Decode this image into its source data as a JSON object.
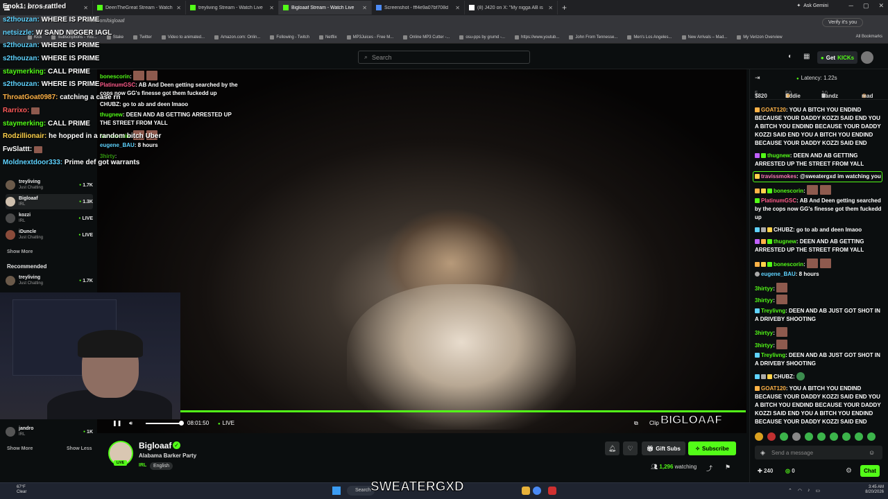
{
  "browser": {
    "tabs": [
      {
        "label": "Enok1 bros rattled",
        "active": false
      },
      {
        "label": "DeenTheGreat Stream - Watch",
        "active": false
      },
      {
        "label": "treyliving Stream - Watch Live",
        "active": false
      },
      {
        "label": "Bigloaaf Stream - Watch Live",
        "active": true
      },
      {
        "label": "Screenshot - fff4e9a07bf708d",
        "active": false
      },
      {
        "label": "(8) J420 on X: \"My nigga AB is",
        "active": false
      }
    ],
    "ask_gemini": "Ask Gemini",
    "url": "kick.com/bigloaaf",
    "verify": "Verify it's you",
    "bookmarks": [
      "Kick",
      "Subscriptions - You...",
      "Stake",
      "Twitter",
      "Video to animated...",
      "Amazon.com: Onlin...",
      "Following - Twitch",
      "Netflix",
      "MP3Juices - Free M...",
      "Online MP3 Cutter -...",
      "osu-pps by grumd -...",
      "https://www.youtub...",
      "John From Tennesse...",
      "Men's Los Angeles...",
      "New Arrivals – Mad...",
      "My Verizon Overview"
    ],
    "all_bookmarks": "All Bookmarks"
  },
  "kick_header": {
    "search_placeholder": "Search",
    "get_kicks": "Get KICKs",
    "get_kicks_prefix": "Get",
    "get_kicks_bold": "KICKs"
  },
  "sidebar": {
    "nav": [
      "Home",
      "Browse",
      "Following",
      "Drops"
    ],
    "following_header": "Following",
    "following": [
      {
        "name": "treyliving",
        "sub": "Just Chatting",
        "viewers": "1.7K"
      },
      {
        "name": "Bigloaaf",
        "sub": "IRL",
        "viewers": "1.3K"
      },
      {
        "name": "kozzi",
        "sub": "IRL",
        "viewers": "LIVE"
      },
      {
        "name": "iDuncle",
        "sub": "Just Chatting",
        "viewers": "LIVE"
      }
    ],
    "show_more": "Show More",
    "recommended_header": "Recommended",
    "recommended": [
      {
        "name": "treyliving",
        "sub": "Just Chatting",
        "viewers": "1.7K"
      }
    ],
    "bottom_item": {
      "name": "jandro",
      "sub": "IRL",
      "viewers": "1K"
    },
    "bottom_show_more": "Show More",
    "bottom_show_less": "Show Less"
  },
  "overlay_chat": [
    {
      "user": "Enok1:",
      "text": "bros rattled",
      "color": "#ffffff"
    },
    {
      "user": "s2thouzan:",
      "text": "WHERE IS PRIME",
      "color": "#5fd3ff"
    },
    {
      "user": "netsizzle:",
      "text": "W SAND NIGGER IAGL",
      "color": "#5fd3ff"
    },
    {
      "user": "s2thouzan:",
      "text": "WHERE IS PRIME",
      "color": "#5fd3ff"
    },
    {
      "user": "s2thouzan:",
      "text": "WHERE IS PRIME",
      "color": "#5fd3ff"
    },
    {
      "user": "staymerking:",
      "text": "CALL PRIME",
      "color": "#53fc18"
    },
    {
      "user": "s2thouzan:",
      "text": "WHERE IS PRIME",
      "color": "#5fd3ff"
    },
    {
      "user": "ThroatGoat0987:",
      "text": "catching a case rn",
      "color": "#ffb347"
    },
    {
      "user": "Rarrixo:",
      "text": "",
      "color": "#ff5b5b"
    },
    {
      "user": "staymerking:",
      "text": "CALL PRIME",
      "color": "#53fc18"
    },
    {
      "user": "Rodzillionair:",
      "text": "he hopped in a random bitch Uber",
      "color": "#ffd24a"
    },
    {
      "user": "FwSlattt:",
      "text": "",
      "color": "#ffffff"
    },
    {
      "user": "Moldnextdoor333:",
      "text": "Prime def got warrants",
      "color": "#5fd3ff"
    }
  ],
  "overlay_chat2": [
    {
      "user": "bonescorin",
      "text": ":",
      "color": "#53fc18"
    },
    {
      "user": "PlatinumGSC",
      "text": ": AB And Deen getting searched by the cops now GG's finesse got them fuckedd up",
      "color": "#ff5b8a"
    },
    {
      "user": "CHUBZ",
      "text": ": go to ab and deen lmaoo",
      "color": "#ffffff"
    },
    {
      "user": "thugnew",
      "text": ": DEEN AND AB GETTING ARRESTED UP THE STREET FROM YALL",
      "color": "#53fc18"
    },
    {
      "user": "bonescorin",
      "text": ":",
      "color": "#53fc18"
    },
    {
      "user": "eugene_BAU",
      "text": ": 8 hours",
      "color": "#5fd3ff"
    },
    {
      "user": "3hirty",
      "text": ":",
      "color": "#53fc18"
    }
  ],
  "player": {
    "time": "08:01:50",
    "live": "LIVE",
    "volume_pct": 100,
    "watermark": "BIGLOAAF",
    "clip": "Clip"
  },
  "stream": {
    "name": "Bigloaaf",
    "title": "Alabama Barker Party",
    "category": "IRL",
    "language": "English",
    "live_badge": "LIVE",
    "gift_subs": "Gift Subs",
    "subscribe": "Subscribe",
    "watching_count": "1,296",
    "watching_label": "watching"
  },
  "chat": {
    "latency": "Latency: 1.22s",
    "leaderboard": [
      {
        "name": "$820",
        "count": "5"
      },
      {
        "name": "Eddie",
        "count": "50"
      },
      {
        "name": "Bandz",
        "count": "10"
      },
      {
        "name": "mad",
        "count": ""
      }
    ],
    "messages": [
      {
        "user": "GOAT120",
        "text": ": YOU A BITCH YOU ENDIND BECAUSE YOUR DADDY KOZZI SAID END YOU A BITCH YOU ENDIND BECAUSE YOUR DADDY KOZZI SAID END YOU A BITCH YOU ENDIND BECAUSE YOUR DADDY KOZZI SAID END",
        "color": "#ffb347"
      },
      {
        "user": "thugnew",
        "text": ": DEEN AND AB GETTING ARRESTED UP THE STREET FROM YALL",
        "color": "#53fc18"
      },
      {
        "user": "travissmokes",
        "text": ": @sweatergxd im watching you",
        "color": "#ff7ab8"
      },
      {
        "user": "bonescorin",
        "text": ":",
        "color": "#53fc18"
      },
      {
        "user": "PlatinumGSC",
        "text": ": AB And Deen getting searched by the cops now GG's finesse got them fuckedd up",
        "color": "#ff5b8a"
      },
      {
        "user": "CHUBZ",
        "text": ": go to ab and deen lmaoo",
        "color": "#ffffff"
      },
      {
        "user": "thugnew",
        "text": ": DEEN AND AB GETTING ARRESTED UP THE STREET FROM YALL",
        "color": "#53fc18"
      },
      {
        "user": "bonescorin",
        "text": ":",
        "color": "#53fc18"
      },
      {
        "user": "eugene_BAU",
        "text": ": 8 hours",
        "color": "#5fd3ff"
      },
      {
        "user": "3hirtyy",
        "text": ":",
        "color": "#53fc18"
      },
      {
        "user": "3hirtyy",
        "text": ":",
        "color": "#53fc18"
      },
      {
        "user": "Treylivng",
        "text": ": DEEN AND AB JUST GOT SHOT IN A DRIVEBY SHOOTING",
        "color": "#53fc18"
      },
      {
        "user": "3hirtyy",
        "text": ":",
        "color": "#53fc18"
      },
      {
        "user": "3hirtyy",
        "text": ":",
        "color": "#53fc18"
      },
      {
        "user": "Treylivng",
        "text": ": DEEN AND AB JUST GOT SHOT IN A DRIVEBY SHOOTING",
        "color": "#53fc18"
      },
      {
        "user": "CHUBZ",
        "text": ":",
        "color": "#ffffff"
      },
      {
        "user": "GOAT120",
        "text": ": YOU A BITCH YOU ENDIND BECAUSE YOUR DADDY KOZZI SAID END YOU A BITCH YOU ENDIND BECAUSE YOUR DADDY KOZZI SAID END YOU A BITCH YOU ENDIND BECAUSE YOUR DADDY KOZZI SAID END",
        "color": "#ffb347"
      }
    ],
    "input_placeholder": "Send a message",
    "kick_points": "240",
    "zero_count": "0",
    "chat_button": "Chat"
  },
  "taskbar": {
    "weather_temp": "67°F",
    "weather_desc": "Clear",
    "search": "Search",
    "brand_overlay": "SWEATERGXD",
    "time": "3:45 AM",
    "date": "8/20/2026"
  },
  "colors": {
    "kick_green": "#53fc18",
    "bg": "#0b0e0f"
  }
}
